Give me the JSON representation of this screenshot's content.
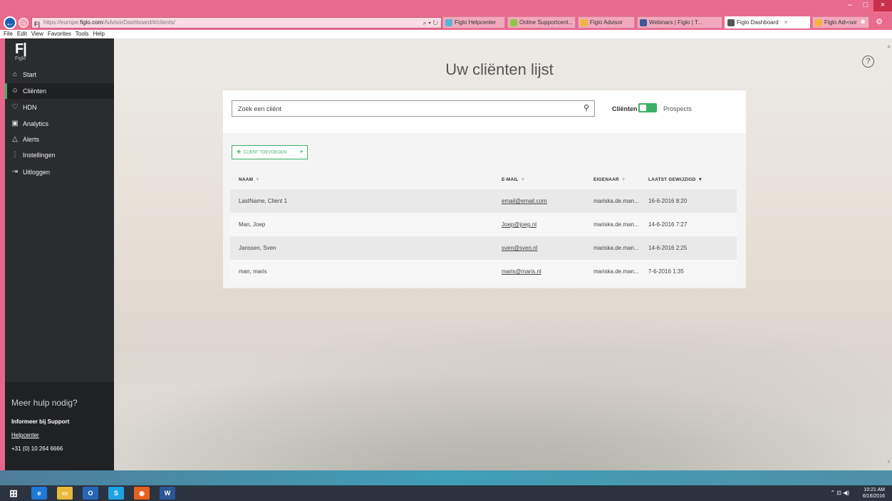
{
  "browser": {
    "favicon_text": "F|",
    "url_prefix": "https://europe.",
    "url_host": "figlo.com",
    "url_path": "/AdvisorDashboard/#/clients/",
    "addr_icons": "⌕ ▾ ↻",
    "tabs": [
      {
        "label": "Figlo Helpcenter",
        "color": "#58b4d7"
      },
      {
        "label": "Online Supportcent...",
        "color": "#8fc74a"
      },
      {
        "label": "Figlo Advisor",
        "color": "#f2b43a"
      },
      {
        "label": "Webinars | Figlo | T...",
        "color": "#3b5998"
      },
      {
        "label": "Figlo Dashboard",
        "color": "#555555",
        "active": true
      },
      {
        "label": "Figlo Advisor",
        "color": "#f2b43a"
      }
    ],
    "tab_close": "×",
    "toolbar_icons": "⌂ ★ ⚙",
    "window_controls": [
      "–",
      "□",
      "×"
    ],
    "menu": [
      "File",
      "Edit",
      "View",
      "Favorites",
      "Tools",
      "Help"
    ]
  },
  "sidebar": {
    "logo_main": "F|",
    "logo_sub": "Figlo",
    "items": [
      {
        "label": "Start",
        "icon": "home-icon",
        "glyph": "⌂"
      },
      {
        "label": "Cliënten",
        "icon": "people-icon",
        "glyph": "☺",
        "active": true
      },
      {
        "label": "HDN",
        "icon": "handshake-icon",
        "glyph": "♡"
      },
      {
        "label": "Analytics",
        "icon": "chart-icon",
        "glyph": "▣"
      },
      {
        "label": "Alerts",
        "icon": "bell-icon",
        "glyph": "△"
      },
      {
        "label": "Instellingen",
        "icon": "sliders-icon",
        "glyph": "⋮"
      },
      {
        "label": "Uitloggen",
        "icon": "logout-icon",
        "glyph": "⇥"
      }
    ],
    "help_title": "Meer hulp nodig?",
    "help_support": "Informeer bij Support",
    "help_link": "Helpcenter",
    "help_phone": "+31 (0) 10 264 6666"
  },
  "help_icon": "?",
  "page": {
    "title": "Uw cliënten lijst",
    "search_placeholder": "Zoek een cliënt",
    "toggle_left": "Cliënten",
    "toggle_right": "Prospects",
    "add_button": "CLIËNT TOEVOEGEN",
    "columns": {
      "naam": "NAAM",
      "email": "E-MAIL",
      "eigenaar": "EIGENAAR",
      "laatst": "LAATST GEWIJZIGD"
    },
    "rows": [
      {
        "naam": "LastName, Client 1",
        "email": "email@email.com",
        "eigenaar": "mariska.de.man...",
        "laatst": "16-6-2016 8:20"
      },
      {
        "naam": "Man, Joep",
        "email": "Joep@joep.nl",
        "eigenaar": "mariska.de.man...",
        "laatst": "14-6-2016 7:27"
      },
      {
        "naam": "Janssen, Sven",
        "email": "sven@sven.nl",
        "eigenaar": "mariska.de.man...",
        "laatst": "14-6-2016 2:25"
      },
      {
        "naam": "man, maris",
        "email": "maris@maris.nl",
        "eigenaar": "mariska.de.man...",
        "laatst": "7-6-2016 1:35"
      }
    ]
  },
  "taskbar": {
    "apps": [
      {
        "name": "windows-start-icon",
        "glyph": "⊞",
        "color": "#2b3340"
      },
      {
        "name": "ie-icon",
        "glyph": "e",
        "color": "#1e7ad6"
      },
      {
        "name": "explorer-icon",
        "glyph": "▭",
        "color": "#e8b93a"
      },
      {
        "name": "outlook-icon",
        "glyph": "O",
        "color": "#2766b7"
      },
      {
        "name": "skype-icon",
        "glyph": "S",
        "color": "#1ea2e2"
      },
      {
        "name": "firefox-icon",
        "glyph": "◉",
        "color": "#e66020"
      },
      {
        "name": "word-icon",
        "glyph": "W",
        "color": "#2b5797"
      }
    ],
    "tray": "⌃ ⊡ ◀)",
    "time": "10:21 AM",
    "date": "6/16/2016"
  }
}
